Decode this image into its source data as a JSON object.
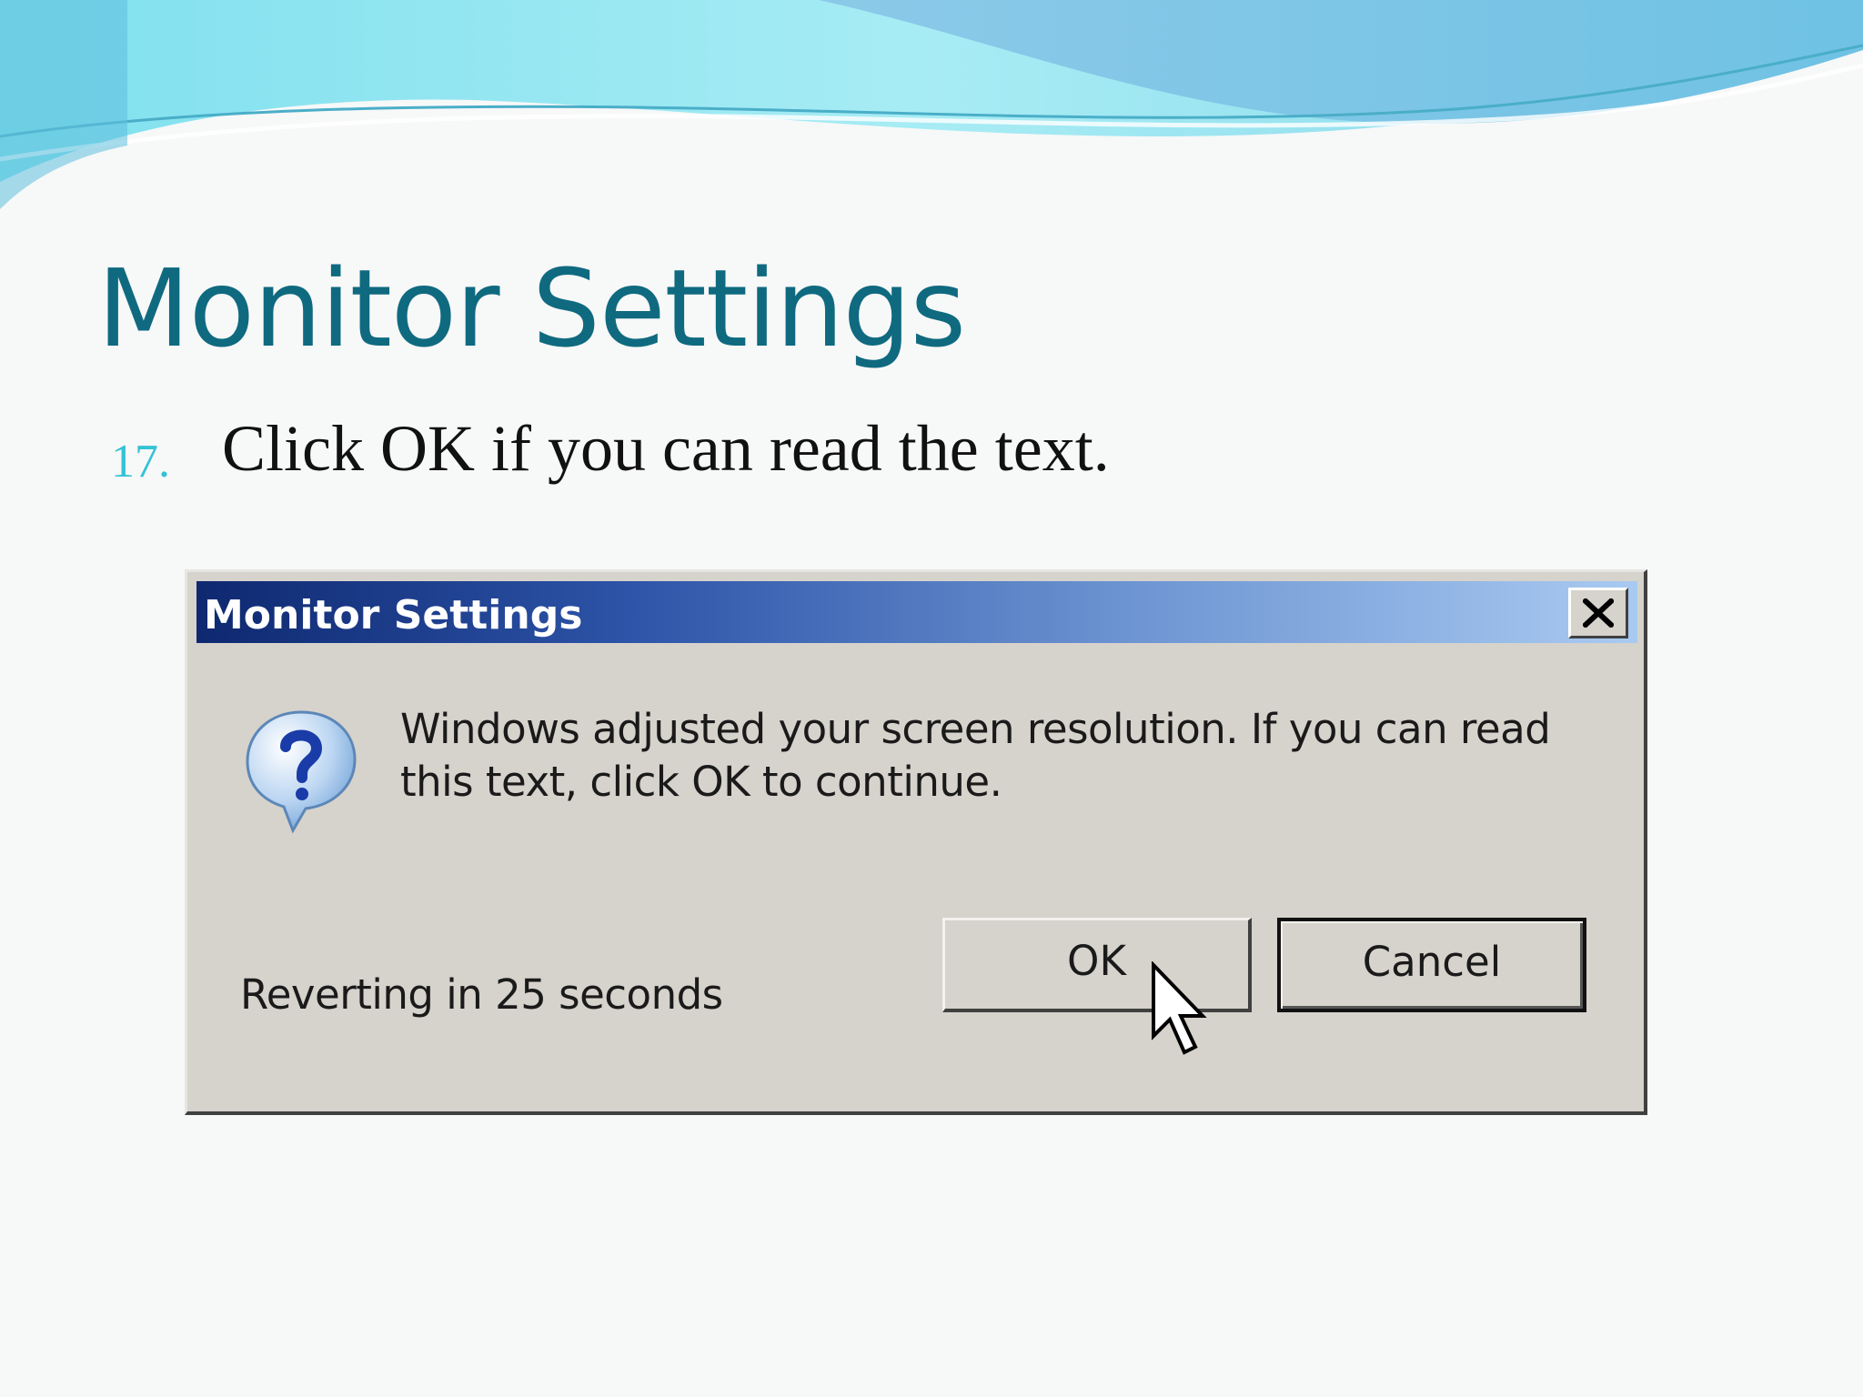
{
  "slide": {
    "title": "Monitor Settings",
    "bullet_number": "17.",
    "bullet_text": "Click OK if you can read the text."
  },
  "dialog": {
    "title": "Monitor Settings",
    "close_label": "×",
    "message": "Windows adjusted your screen resolution. If you can read this text, click OK to continue.",
    "countdown_text": "Reverting in 25 seconds",
    "ok_label": "OK",
    "cancel_label": "Cancel"
  },
  "colors": {
    "title_teal": "#0f6a80",
    "bullet_cyan": "#32c3d6",
    "titlebar_start": "#0e2870",
    "titlebar_end": "#a9caf1",
    "dialog_face": "#d6d2cc"
  },
  "icons": {
    "dialog_icon": "question-balloon-icon",
    "close": "close-x-icon",
    "pointer": "mouse-cursor-icon"
  }
}
